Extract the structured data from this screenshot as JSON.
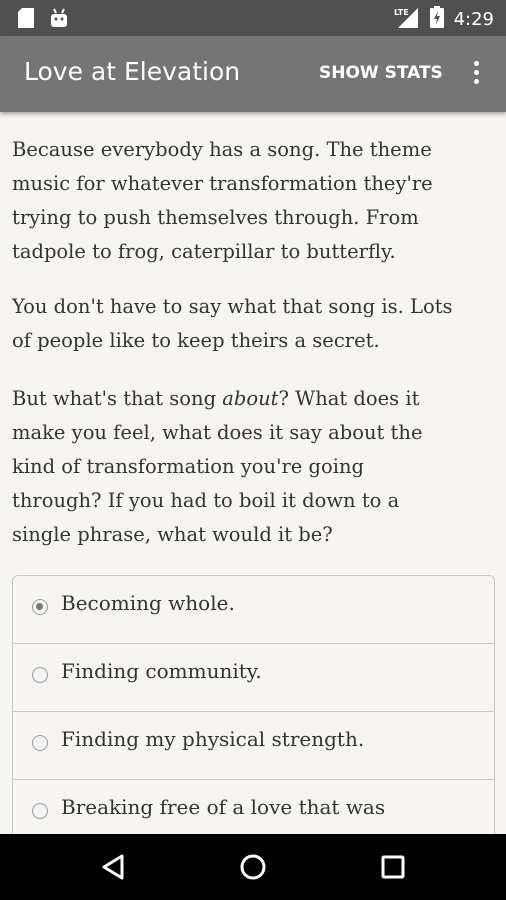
{
  "status_bar": {
    "icons": [
      "sd-card-icon",
      "android-icon",
      "lte-signal-icon",
      "battery-icon"
    ],
    "network": "LTE",
    "time": "4:29"
  },
  "app_bar": {
    "title": "Love at Elevation",
    "show_stats": "SHOW STATS",
    "overflow_icon": "overflow-menu-icon"
  },
  "content": {
    "paragraph1": [
      "Because everybody has a song. The theme",
      "music for whatever transformation they're",
      "trying to push themselves through. From",
      "tadpole to frog, caterpillar to butterfly."
    ],
    "paragraph2": [
      "You don't have to say what that song is. Lots",
      "of people like to keep theirs a secret."
    ],
    "paragraph3": {
      "line1_before": "But what's that song ",
      "line1_emphasis": "about",
      "line1_after": "? What does it",
      "rest": [
        "make you feel, what does it say about the",
        "kind of transformation you're going",
        "through? If you had to boil it down to a",
        "single phrase, what would it be?"
      ]
    },
    "options": [
      {
        "label": "Becoming whole.",
        "selected": true
      },
      {
        "label": "Finding community.",
        "selected": false
      },
      {
        "label": "Finding my physical strength.",
        "selected": false
      },
      {
        "label": "Breaking free of a love that was",
        "selected": false
      }
    ]
  },
  "nav_bar": {
    "buttons": [
      "back-icon",
      "home-icon",
      "recents-icon"
    ]
  }
}
